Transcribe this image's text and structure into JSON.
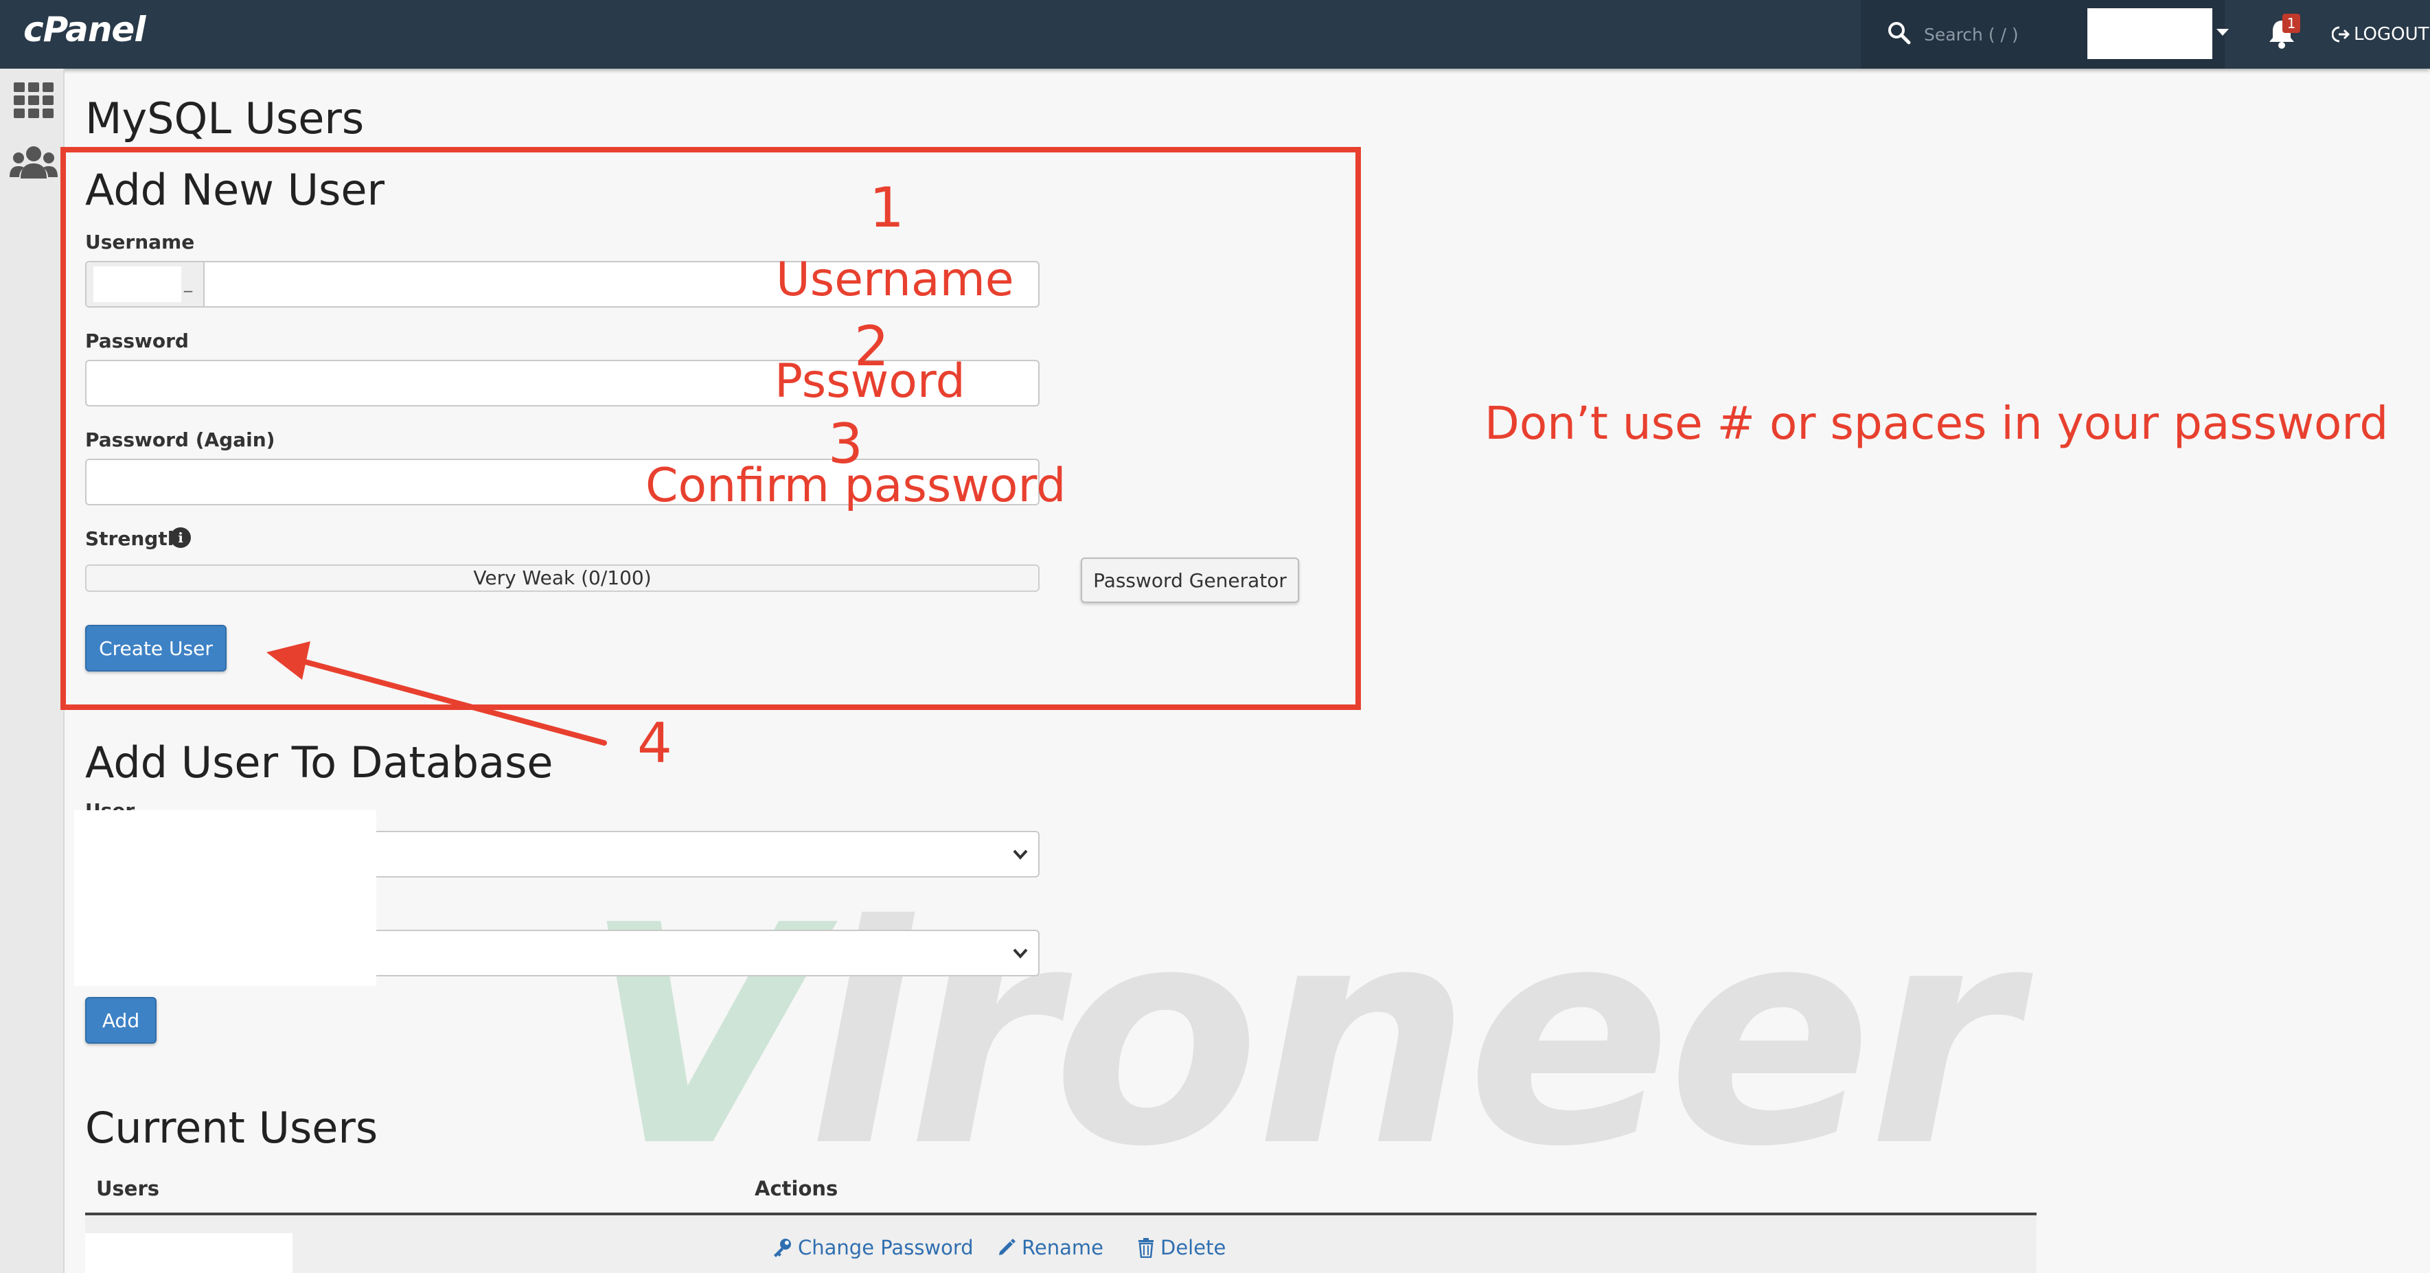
{
  "topbar": {
    "logo": "cPanel",
    "search_placeholder": "Search ( / )",
    "notification_count": "1",
    "logout_label": "LOGOUT"
  },
  "page": {
    "title": "MySQL Users"
  },
  "add_user": {
    "heading": "Add New User",
    "username_label": "Username",
    "username_prefix_separator": "_",
    "password_label": "Password",
    "password_again_label": "Password (Again)",
    "strength_label": "Strength",
    "strength_text": "Very Weak (0/100)",
    "strength_value": 0,
    "password_generator_label": "Password Generator",
    "create_button_label": "Create User"
  },
  "add_to_db": {
    "heading": "Add User To Database",
    "user_label": "User",
    "add_button_label": "Add"
  },
  "current_users": {
    "heading": "Current Users",
    "columns": [
      "Users",
      "Actions"
    ],
    "actions": [
      "Change Password",
      "Rename",
      "Delete"
    ]
  },
  "annotations": {
    "step1_number": "1",
    "step1_text": "Username",
    "step2_number": "2",
    "step2_text": "Pssword",
    "step3_number": "3",
    "step3_text": "Confirm password",
    "step4_number": "4",
    "note": "Don’t use # or spaces in your password",
    "color": "#e8402f"
  },
  "watermark": {
    "first": "V",
    "rest": "ironeer"
  },
  "colors": {
    "topbar": "#293a4a",
    "primary_button": "#3e82c6",
    "link": "#2f6fb0"
  }
}
